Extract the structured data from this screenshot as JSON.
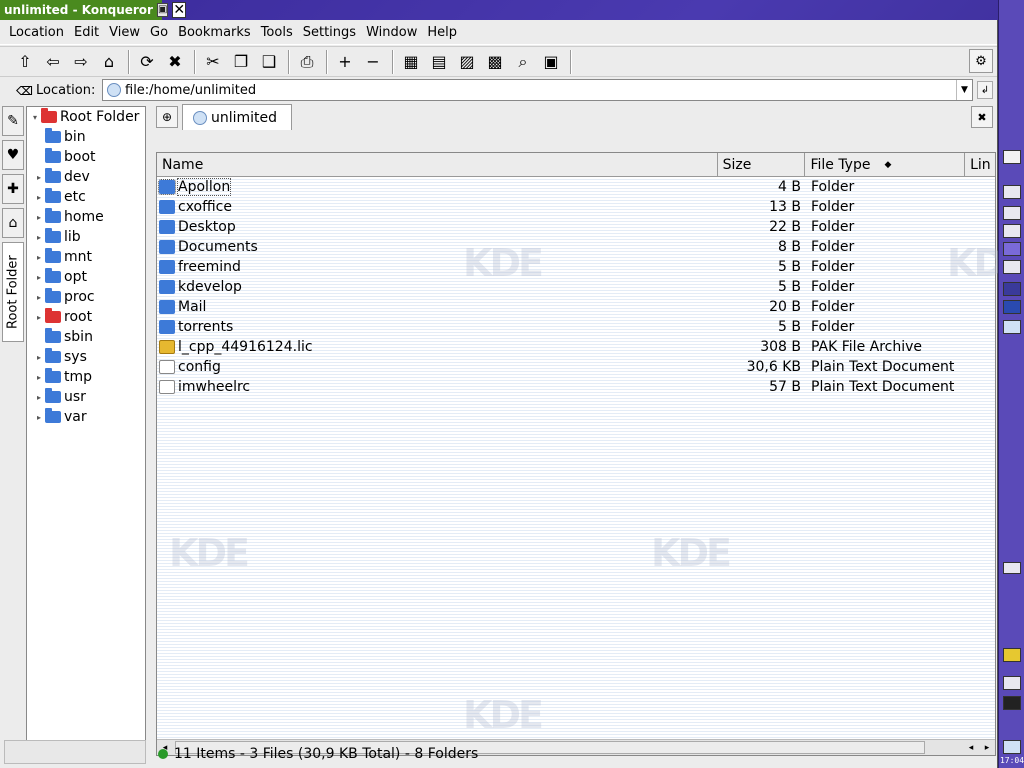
{
  "window": {
    "title": "unlimited - Konqueror",
    "minimize_glyph": "▣",
    "close_glyph": "✕"
  },
  "menubar": {
    "items": [
      {
        "label": "Location"
      },
      {
        "label": "Edit"
      },
      {
        "label": "View"
      },
      {
        "label": "Go"
      },
      {
        "label": "Bookmarks"
      },
      {
        "label": "Tools"
      },
      {
        "label": "Settings"
      },
      {
        "label": "Window"
      },
      {
        "label": "Help"
      }
    ]
  },
  "toolbar": {
    "buttons": [
      {
        "name": "up-button",
        "icon": "up-arrow-icon",
        "glyph": "⇧"
      },
      {
        "name": "back-button",
        "icon": "back-arrow-icon",
        "glyph": "⇦"
      },
      {
        "name": "forward-button",
        "icon": "forward-arrow-icon",
        "glyph": "⇨"
      },
      {
        "name": "home-button",
        "icon": "home-icon",
        "glyph": "⌂"
      },
      {
        "name": "reload-button",
        "icon": "reload-icon",
        "glyph": "⟳"
      },
      {
        "name": "stop-button",
        "icon": "stop-icon",
        "glyph": "✖"
      },
      {
        "name": "cut-button",
        "icon": "scissors-icon",
        "glyph": "✂"
      },
      {
        "name": "copy-button",
        "icon": "copy-icon",
        "glyph": "❐"
      },
      {
        "name": "paste-button",
        "icon": "paste-icon",
        "glyph": "❑"
      },
      {
        "name": "print-button",
        "icon": "printer-icon",
        "glyph": "⎙"
      },
      {
        "name": "zoom-in-button",
        "icon": "plus-icon",
        "glyph": "+"
      },
      {
        "name": "zoom-out-button",
        "icon": "minus-icon",
        "glyph": "−"
      },
      {
        "name": "icon-view-button",
        "icon": "icon-view-icon",
        "glyph": "▦"
      },
      {
        "name": "detail-view-button",
        "icon": "detail-view-icon",
        "glyph": "▤"
      },
      {
        "name": "thumbnail-button",
        "icon": "image-icon",
        "glyph": "▨"
      },
      {
        "name": "multicolumn-button",
        "icon": "grid-icon",
        "glyph": "▩"
      },
      {
        "name": "find-button",
        "icon": "magnifier-icon",
        "glyph": "⌕"
      },
      {
        "name": "terminal-button",
        "icon": "terminal-icon",
        "glyph": "▣"
      }
    ],
    "settings_glyph": "⚙"
  },
  "location": {
    "label": "Location:",
    "icon_glyph": "⌫",
    "value": "file:/home/unlimited",
    "drop_glyph": "▼",
    "clear_glyph": "↲"
  },
  "sidebar": {
    "tabs": [
      {
        "name": "sidebar-tab-tools",
        "glyph": "✎"
      },
      {
        "name": "sidebar-tab-bookmarks",
        "glyph": "♥"
      },
      {
        "name": "sidebar-tab-services",
        "glyph": "✚"
      },
      {
        "name": "sidebar-tab-home",
        "glyph": "⌂"
      }
    ],
    "active_tab": "Root Folder",
    "tree": [
      {
        "label": "Root Folder",
        "expander": "▾",
        "red": true,
        "indent": 0
      },
      {
        "label": "bin",
        "expander": "",
        "red": false,
        "indent": 1
      },
      {
        "label": "boot",
        "expander": "",
        "red": false,
        "indent": 1
      },
      {
        "label": "dev",
        "expander": "▸",
        "red": false,
        "indent": 1
      },
      {
        "label": "etc",
        "expander": "▸",
        "red": false,
        "indent": 1
      },
      {
        "label": "home",
        "expander": "▸",
        "red": false,
        "indent": 1
      },
      {
        "label": "lib",
        "expander": "▸",
        "red": false,
        "indent": 1
      },
      {
        "label": "mnt",
        "expander": "▸",
        "red": false,
        "indent": 1
      },
      {
        "label": "opt",
        "expander": "▸",
        "red": false,
        "indent": 1
      },
      {
        "label": "proc",
        "expander": "▸",
        "red": false,
        "indent": 1
      },
      {
        "label": "root",
        "expander": "▸",
        "red": true,
        "indent": 1
      },
      {
        "label": "sbin",
        "expander": "",
        "red": false,
        "indent": 1
      },
      {
        "label": "sys",
        "expander": "▸",
        "red": false,
        "indent": 1
      },
      {
        "label": "tmp",
        "expander": "▸",
        "red": false,
        "indent": 1
      },
      {
        "label": "usr",
        "expander": "▸",
        "red": false,
        "indent": 1
      },
      {
        "label": "var",
        "expander": "▸",
        "red": false,
        "indent": 1
      }
    ]
  },
  "tabs": {
    "current": "unlimited",
    "new_glyph": "⊕",
    "close_glyph": "✖"
  },
  "listview": {
    "columns": [
      "Name",
      "Size",
      "File Type",
      "Lin"
    ],
    "sort_glyph": "◆",
    "rows": [
      {
        "name": "Apollon",
        "size": "4 B",
        "type": "Folder",
        "kind": "folder"
      },
      {
        "name": "cxoffice",
        "size": "13 B",
        "type": "Folder",
        "kind": "folder"
      },
      {
        "name": "Desktop",
        "size": "22 B",
        "type": "Folder",
        "kind": "folder"
      },
      {
        "name": "Documents",
        "size": "8 B",
        "type": "Folder",
        "kind": "folder"
      },
      {
        "name": "freemind",
        "size": "5 B",
        "type": "Folder",
        "kind": "folder"
      },
      {
        "name": "kdevelop",
        "size": "5 B",
        "type": "Folder",
        "kind": "folder"
      },
      {
        "name": "Mail",
        "size": "20 B",
        "type": "Folder",
        "kind": "folder"
      },
      {
        "name": "torrents",
        "size": "5 B",
        "type": "Folder",
        "kind": "folder"
      },
      {
        "name": "l_cpp_44916124.lic",
        "size": "308 B",
        "type": "PAK File Archive",
        "kind": "pak"
      },
      {
        "name": "config",
        "size": "30,6 KB",
        "type": "Plain Text Document",
        "kind": "doc"
      },
      {
        "name": "imwheelrc",
        "size": "57 B",
        "type": "Plain Text Document",
        "kind": "doc"
      }
    ],
    "scroll_left": "◂",
    "scroll_right": "▸",
    "watermark": "KDE"
  },
  "status": {
    "text": "11 Items - 3 Files (30,9 KB Total) - 8 Folders"
  },
  "panel": {
    "clock": "17:04"
  },
  "colors": {
    "titlebar": "#4a8a1e",
    "folder": "#3d7ad8",
    "root_folder": "#d33333",
    "panel": "#5a4ab8"
  }
}
